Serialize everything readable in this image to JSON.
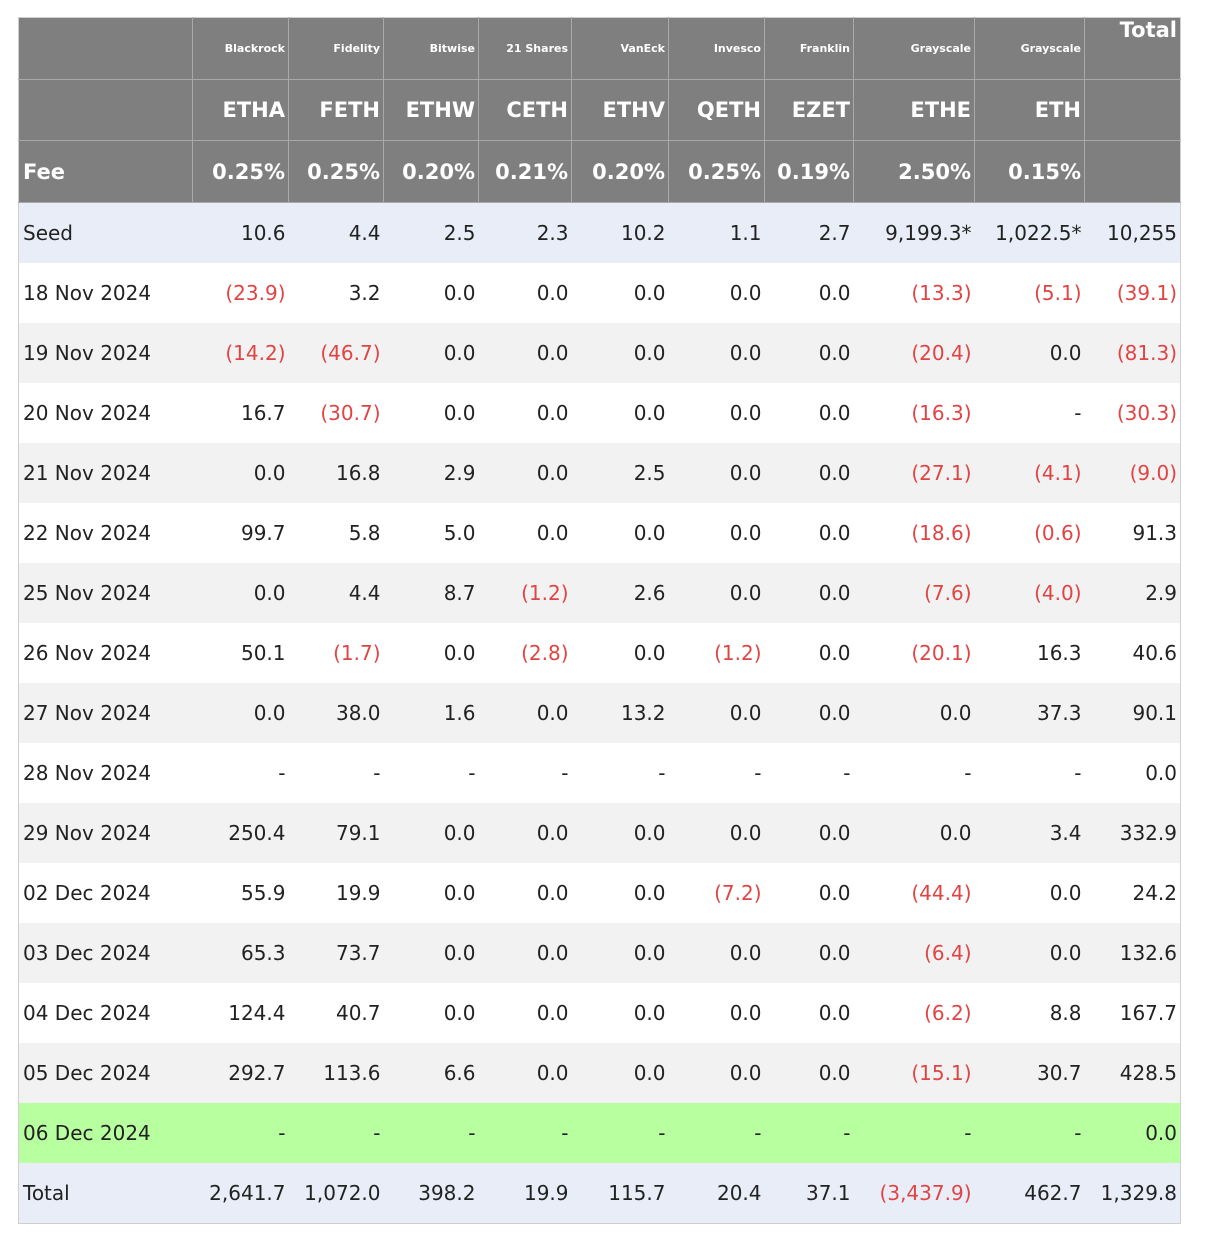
{
  "table": {
    "header": {
      "issuers": [
        "Blackrock",
        "Fidelity",
        "Bitwise",
        "21 Shares",
        "VanEck",
        "Invesco",
        "Franklin",
        "Grayscale",
        "Grayscale"
      ],
      "total_label": "Total",
      "tickers": [
        "ETHA",
        "FETH",
        "ETHW",
        "CETH",
        "ETHV",
        "QETH",
        "EZET",
        "ETHE",
        "ETH"
      ],
      "fee_label": "Fee",
      "fees": [
        "0.25%",
        "0.25%",
        "0.20%",
        "0.21%",
        "0.20%",
        "0.25%",
        "0.19%",
        "2.50%",
        "0.15%"
      ]
    },
    "rows": [
      {
        "label": "Seed",
        "values": [
          "10.6",
          "4.4",
          "2.5",
          "2.3",
          "10.2",
          "1.1",
          "2.7",
          "9,199.3*",
          "1,022.5*",
          "10,255"
        ]
      },
      {
        "label": "18 Nov 2024",
        "values": [
          "(23.9)",
          "3.2",
          "0.0",
          "0.0",
          "0.0",
          "0.0",
          "0.0",
          "(13.3)",
          "(5.1)",
          "(39.1)"
        ]
      },
      {
        "label": "19 Nov 2024",
        "values": [
          "(14.2)",
          "(46.7)",
          "0.0",
          "0.0",
          "0.0",
          "0.0",
          "0.0",
          "(20.4)",
          "0.0",
          "(81.3)"
        ]
      },
      {
        "label": "20 Nov 2024",
        "values": [
          "16.7",
          "(30.7)",
          "0.0",
          "0.0",
          "0.0",
          "0.0",
          "0.0",
          "(16.3)",
          "-",
          "(30.3)"
        ]
      },
      {
        "label": "21 Nov 2024",
        "values": [
          "0.0",
          "16.8",
          "2.9",
          "0.0",
          "2.5",
          "0.0",
          "0.0",
          "(27.1)",
          "(4.1)",
          "(9.0)"
        ]
      },
      {
        "label": "22 Nov 2024",
        "values": [
          "99.7",
          "5.8",
          "5.0",
          "0.0",
          "0.0",
          "0.0",
          "0.0",
          "(18.6)",
          "(0.6)",
          "91.3"
        ]
      },
      {
        "label": "25 Nov 2024",
        "values": [
          "0.0",
          "4.4",
          "8.7",
          "(1.2)",
          "2.6",
          "0.0",
          "0.0",
          "(7.6)",
          "(4.0)",
          "2.9"
        ]
      },
      {
        "label": "26 Nov 2024",
        "values": [
          "50.1",
          "(1.7)",
          "0.0",
          "(2.8)",
          "0.0",
          "(1.2)",
          "0.0",
          "(20.1)",
          "16.3",
          "40.6"
        ]
      },
      {
        "label": "27 Nov 2024",
        "values": [
          "0.0",
          "38.0",
          "1.6",
          "0.0",
          "13.2",
          "0.0",
          "0.0",
          "0.0",
          "37.3",
          "90.1"
        ]
      },
      {
        "label": "28 Nov 2024",
        "values": [
          "-",
          "-",
          "-",
          "-",
          "-",
          "-",
          "-",
          "-",
          "-",
          "0.0"
        ]
      },
      {
        "label": "29 Nov 2024",
        "values": [
          "250.4",
          "79.1",
          "0.0",
          "0.0",
          "0.0",
          "0.0",
          "0.0",
          "0.0",
          "3.4",
          "332.9"
        ]
      },
      {
        "label": "02 Dec 2024",
        "values": [
          "55.9",
          "19.9",
          "0.0",
          "0.0",
          "0.0",
          "(7.2)",
          "0.0",
          "(44.4)",
          "0.0",
          "24.2"
        ]
      },
      {
        "label": "03 Dec 2024",
        "values": [
          "65.3",
          "73.7",
          "0.0",
          "0.0",
          "0.0",
          "0.0",
          "0.0",
          "(6.4)",
          "0.0",
          "132.6"
        ]
      },
      {
        "label": "04 Dec 2024",
        "values": [
          "124.4",
          "40.7",
          "0.0",
          "0.0",
          "0.0",
          "0.0",
          "0.0",
          "(6.2)",
          "8.8",
          "167.7"
        ]
      },
      {
        "label": "05 Dec 2024",
        "values": [
          "292.7",
          "113.6",
          "6.6",
          "0.0",
          "0.0",
          "0.0",
          "0.0",
          "(15.1)",
          "30.7",
          "428.5"
        ]
      },
      {
        "label": "06 Dec 2024",
        "values": [
          "-",
          "-",
          "-",
          "-",
          "-",
          "-",
          "-",
          "-",
          "-",
          "0.0"
        ]
      }
    ],
    "total": {
      "label": "Total",
      "values": [
        "2,641.7",
        "1,072.0",
        "398.2",
        "19.9",
        "115.7",
        "20.4",
        "37.1",
        "(3,437.9)",
        "462.7",
        "1,329.8"
      ]
    },
    "colors": {
      "header_bg": "#7f7f7f",
      "header_text": "#ffffff",
      "negative_text": "#e04444",
      "highlight_row_bg": "#b8ff9f",
      "seed_total_row_bg": "#e8edf7",
      "alt_row_bg": "#f2f2f2"
    }
  }
}
